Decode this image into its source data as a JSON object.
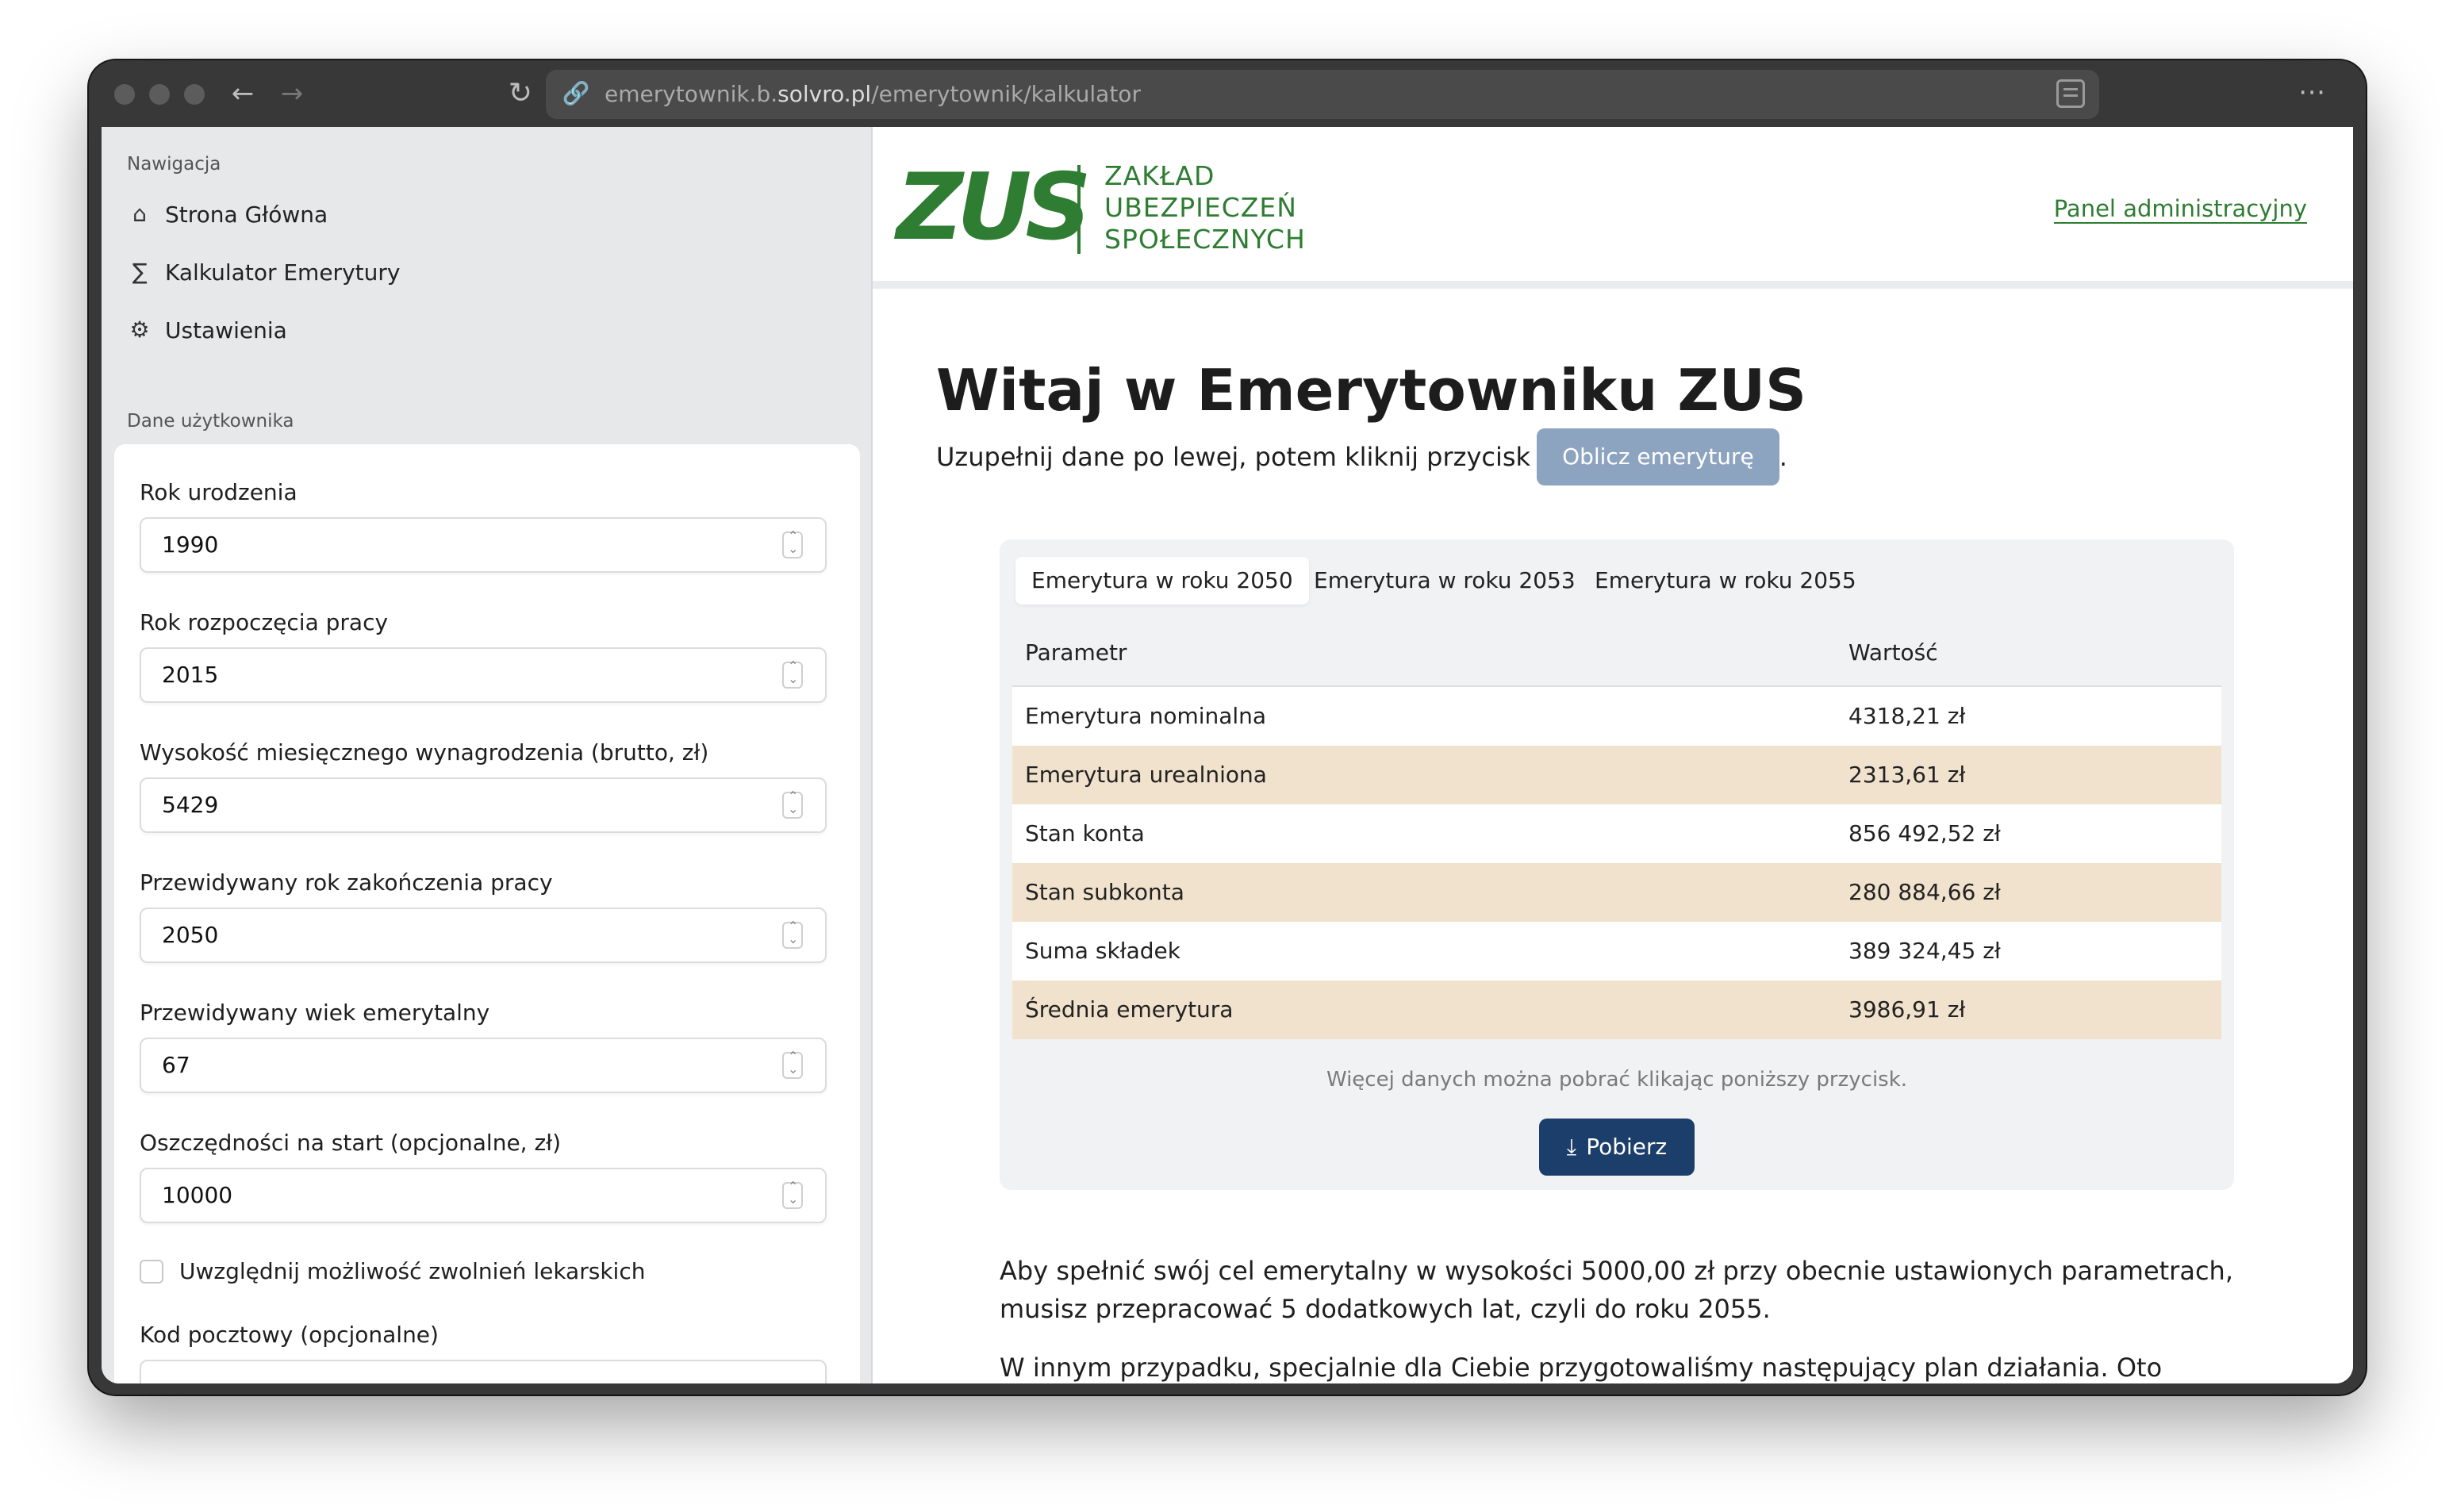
{
  "browser": {
    "url_prefix": "emerytownik.b.",
    "url_host": "solvro.pl",
    "url_path": "/emerytownik/kalkulator"
  },
  "sidebar": {
    "nav_label": "Nawigacja",
    "items": [
      {
        "label": "Strona Główna",
        "icon": "home-icon"
      },
      {
        "label": "Kalkulator Emerytury",
        "icon": "sigma-icon"
      },
      {
        "label": "Ustawienia",
        "icon": "gear-icon"
      }
    ],
    "user_label": "Dane użytkownika",
    "fields": [
      {
        "label": "Rok urodzenia",
        "value": "1990"
      },
      {
        "label": "Rok rozpoczęcia pracy",
        "value": "2015"
      },
      {
        "label": "Wysokość miesięcznego wynagrodzenia (brutto, zł)",
        "value": "5429"
      },
      {
        "label": "Przewidywany rok zakończenia pracy",
        "value": "2050"
      },
      {
        "label": "Przewidywany wiek emerytalny",
        "value": "67"
      },
      {
        "label": "Oszczędności na start (opcjonalne, zł)",
        "value": "10000"
      }
    ],
    "checkbox_label": "Uwzględnij możliwość zwolnień lekarskich",
    "postal_label": "Kod pocztowy (opcjonalne)"
  },
  "header": {
    "logo_mark": "ZUS",
    "logo_line1": "ZAKŁAD",
    "logo_line2": "UBEZPIECZEŃ",
    "logo_line3": "SPOŁECZNYCH",
    "admin_link": "Panel administracyjny"
  },
  "main": {
    "title": "Witaj w Emerytowniku ZUS",
    "subtitle": "Uzupełnij dane po lewej, potem kliknij przycisk",
    "calc_button": "Oblicz emeryturę",
    "subtitle_end": "."
  },
  "results": {
    "tabs": [
      "Emerytura w roku 2050",
      "Emerytura w roku 2053",
      "Emerytura w roku 2055"
    ],
    "col_param": "Parametr",
    "col_value": "Wartość",
    "rows": [
      {
        "param": "Emerytura nominalna",
        "value": "4318,21 zł"
      },
      {
        "param": "Emerytura urealniona",
        "value": "2313,61 zł"
      },
      {
        "param": "Stan konta",
        "value": "856 492,52 zł"
      },
      {
        "param": "Stan subkonta",
        "value": "280 884,66 zł"
      },
      {
        "param": "Suma składek",
        "value": "389 324,45 zł"
      },
      {
        "param": "Średnia emerytura",
        "value": "3986,91 zł"
      }
    ],
    "note": "Więcej danych można pobrać klikając poniższy przycisk.",
    "download_button": "Pobierz"
  },
  "paragraphs": {
    "goal_1": "Aby spełnić swój cel emerytalny w wysokości 5000,00 zł przy obecnie ustawionych parametrach,",
    "goal_2": "musisz przepracować 5 dodatkowych lat, czyli do roku 2055.",
    "plan": "W innym przypadku, specjalnie dla Ciebie przygotowaliśmy następujący plan działania. Oto nasze"
  },
  "colors": {
    "brand_green": "#2e7d32",
    "navy_button": "#1c3e6b",
    "disabled_button": "#8da4c0",
    "row_highlight": "#f1e2cd"
  }
}
